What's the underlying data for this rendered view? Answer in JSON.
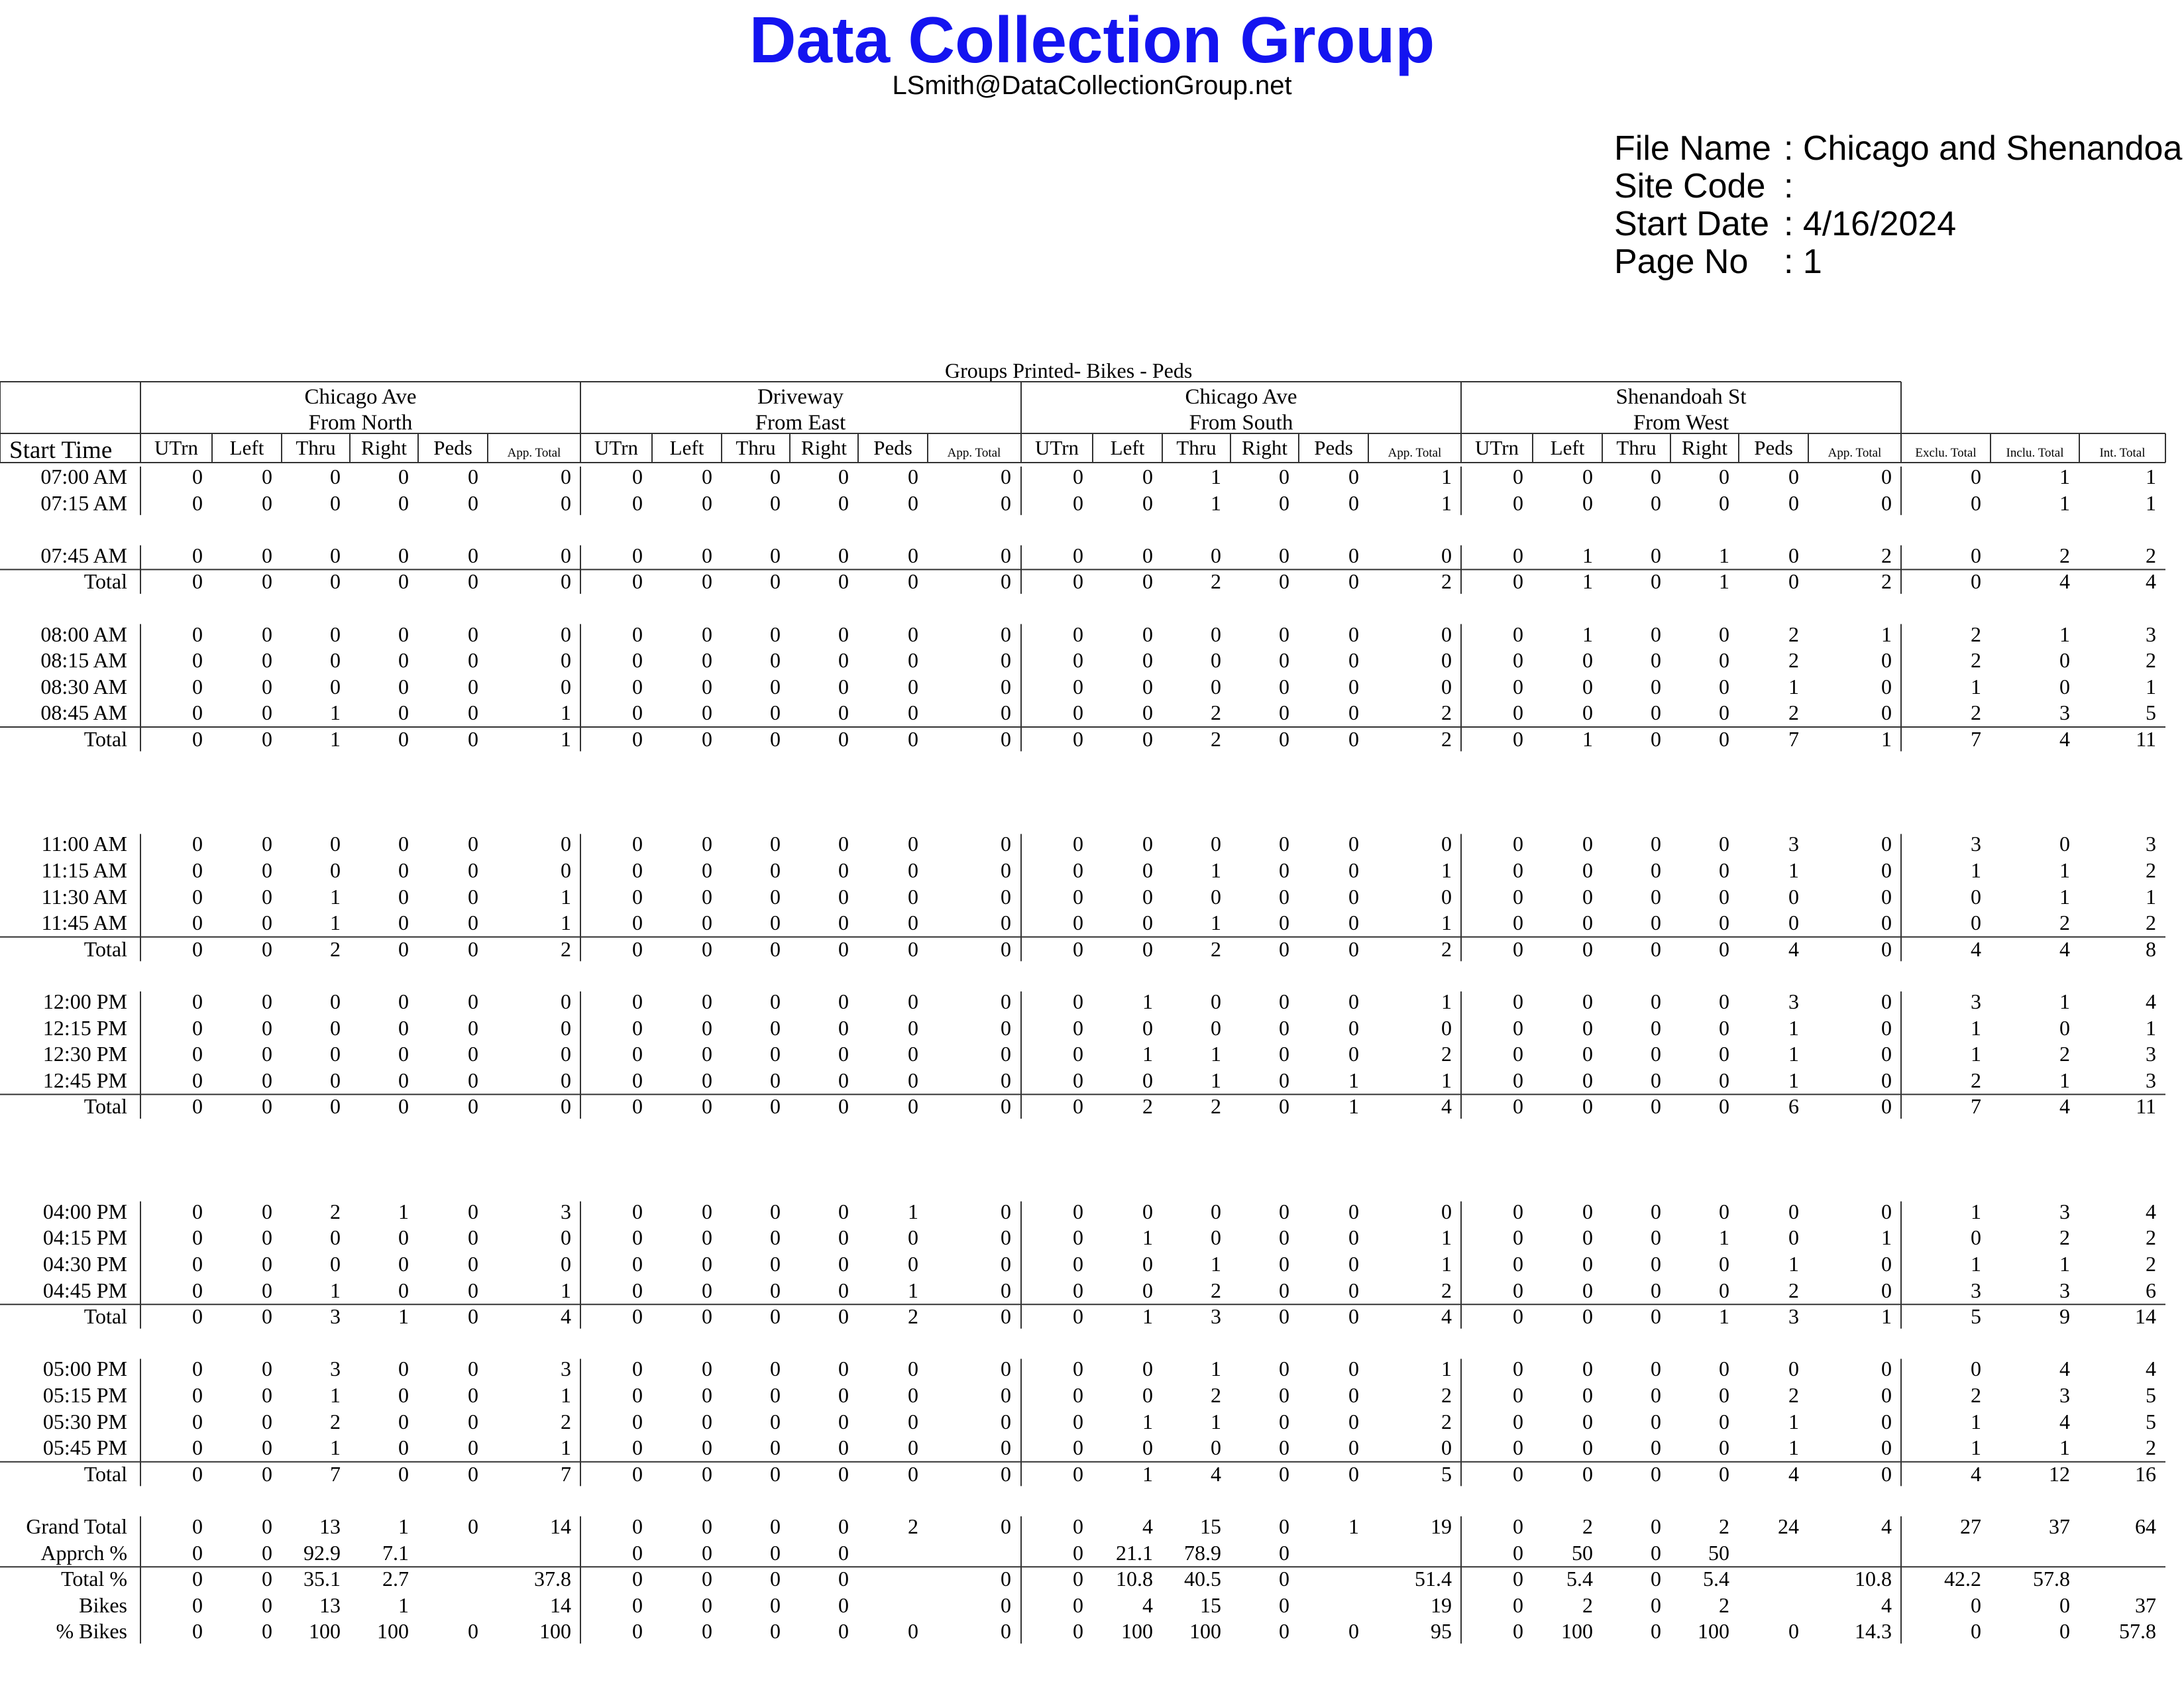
{
  "header": {
    "company": "Data Collection Group",
    "email": "LSmith@DataCollectionGroup.net",
    "info": [
      {
        "key": "File Name",
        "value": ": Chicago and Shenandoah"
      },
      {
        "key": "Site Code",
        "value": ":"
      },
      {
        "key": "Start Date",
        "value": ": 4/16/2024"
      },
      {
        "key": "Page No",
        "value": ": 1"
      }
    ]
  },
  "groups_printed": "Groups Printed- Bikes - Peds",
  "table": {
    "start_time_label": "Start Time",
    "approaches": [
      {
        "name": "Chicago Ave",
        "direction": "From North"
      },
      {
        "name": "Driveway",
        "direction": "From East"
      },
      {
        "name": "Chicago Ave",
        "direction": "From South"
      },
      {
        "name": "Shenandoah St",
        "direction": "From West"
      }
    ],
    "approach_columns": [
      "UTrn",
      "Left",
      "Thru",
      "Right",
      "Peds",
      "App. Total"
    ],
    "total_columns": [
      "Exclu. Total",
      "Inclu. Total",
      "Int. Total"
    ],
    "rows": [
      {
        "label": "07:00 AM",
        "type": "data",
        "values": [
          "0",
          "0",
          "0",
          "0",
          "0",
          "0",
          "0",
          "0",
          "0",
          "0",
          "0",
          "0",
          "0",
          "0",
          "1",
          "0",
          "0",
          "1",
          "0",
          "0",
          "0",
          "0",
          "0",
          "0",
          "0",
          "1",
          "1"
        ]
      },
      {
        "label": "07:15 AM",
        "type": "data",
        "values": [
          "0",
          "0",
          "0",
          "0",
          "0",
          "0",
          "0",
          "0",
          "0",
          "0",
          "0",
          "0",
          "0",
          "0",
          "1",
          "0",
          "0",
          "1",
          "0",
          "0",
          "0",
          "0",
          "0",
          "0",
          "0",
          "1",
          "1"
        ]
      },
      {
        "label": "",
        "type": "gap"
      },
      {
        "label": "07:45 AM",
        "type": "data",
        "values": [
          "0",
          "0",
          "0",
          "0",
          "0",
          "0",
          "0",
          "0",
          "0",
          "0",
          "0",
          "0",
          "0",
          "0",
          "0",
          "0",
          "0",
          "0",
          "0",
          "1",
          "0",
          "1",
          "0",
          "2",
          "0",
          "2",
          "2"
        ]
      },
      {
        "label": "Total",
        "type": "total",
        "values": [
          "0",
          "0",
          "0",
          "0",
          "0",
          "0",
          "0",
          "0",
          "0",
          "0",
          "0",
          "0",
          "0",
          "0",
          "2",
          "0",
          "0",
          "2",
          "0",
          "1",
          "0",
          "1",
          "0",
          "2",
          "0",
          "4",
          "4"
        ]
      },
      {
        "label": "",
        "type": "gap"
      },
      {
        "label": "08:00 AM",
        "type": "data",
        "values": [
          "0",
          "0",
          "0",
          "0",
          "0",
          "0",
          "0",
          "0",
          "0",
          "0",
          "0",
          "0",
          "0",
          "0",
          "0",
          "0",
          "0",
          "0",
          "0",
          "1",
          "0",
          "0",
          "2",
          "1",
          "2",
          "1",
          "3"
        ]
      },
      {
        "label": "08:15 AM",
        "type": "data",
        "values": [
          "0",
          "0",
          "0",
          "0",
          "0",
          "0",
          "0",
          "0",
          "0",
          "0",
          "0",
          "0",
          "0",
          "0",
          "0",
          "0",
          "0",
          "0",
          "0",
          "0",
          "0",
          "0",
          "2",
          "0",
          "2",
          "0",
          "2"
        ]
      },
      {
        "label": "08:30 AM",
        "type": "data",
        "values": [
          "0",
          "0",
          "0",
          "0",
          "0",
          "0",
          "0",
          "0",
          "0",
          "0",
          "0",
          "0",
          "0",
          "0",
          "0",
          "0",
          "0",
          "0",
          "0",
          "0",
          "0",
          "0",
          "1",
          "0",
          "1",
          "0",
          "1"
        ]
      },
      {
        "label": "08:45 AM",
        "type": "data",
        "values": [
          "0",
          "0",
          "1",
          "0",
          "0",
          "1",
          "0",
          "0",
          "0",
          "0",
          "0",
          "0",
          "0",
          "0",
          "2",
          "0",
          "0",
          "2",
          "0",
          "0",
          "0",
          "0",
          "2",
          "0",
          "2",
          "3",
          "5"
        ]
      },
      {
        "label": "Total",
        "type": "total",
        "values": [
          "0",
          "0",
          "1",
          "0",
          "0",
          "1",
          "0",
          "0",
          "0",
          "0",
          "0",
          "0",
          "0",
          "0",
          "2",
          "0",
          "0",
          "2",
          "0",
          "1",
          "0",
          "0",
          "7",
          "1",
          "7",
          "4",
          "11"
        ]
      },
      {
        "label": "",
        "type": "gap"
      },
      {
        "label": "",
        "type": "gap"
      },
      {
        "label": "",
        "type": "gap"
      },
      {
        "label": "11:00 AM",
        "type": "data",
        "values": [
          "0",
          "0",
          "0",
          "0",
          "0",
          "0",
          "0",
          "0",
          "0",
          "0",
          "0",
          "0",
          "0",
          "0",
          "0",
          "0",
          "0",
          "0",
          "0",
          "0",
          "0",
          "0",
          "3",
          "0",
          "3",
          "0",
          "3"
        ]
      },
      {
        "label": "11:15 AM",
        "type": "data",
        "values": [
          "0",
          "0",
          "0",
          "0",
          "0",
          "0",
          "0",
          "0",
          "0",
          "0",
          "0",
          "0",
          "0",
          "0",
          "1",
          "0",
          "0",
          "1",
          "0",
          "0",
          "0",
          "0",
          "1",
          "0",
          "1",
          "1",
          "2"
        ]
      },
      {
        "label": "11:30 AM",
        "type": "data",
        "values": [
          "0",
          "0",
          "1",
          "0",
          "0",
          "1",
          "0",
          "0",
          "0",
          "0",
          "0",
          "0",
          "0",
          "0",
          "0",
          "0",
          "0",
          "0",
          "0",
          "0",
          "0",
          "0",
          "0",
          "0",
          "0",
          "1",
          "1"
        ]
      },
      {
        "label": "11:45 AM",
        "type": "data",
        "values": [
          "0",
          "0",
          "1",
          "0",
          "0",
          "1",
          "0",
          "0",
          "0",
          "0",
          "0",
          "0",
          "0",
          "0",
          "1",
          "0",
          "0",
          "1",
          "0",
          "0",
          "0",
          "0",
          "0",
          "0",
          "0",
          "2",
          "2"
        ]
      },
      {
        "label": "Total",
        "type": "total",
        "values": [
          "0",
          "0",
          "2",
          "0",
          "0",
          "2",
          "0",
          "0",
          "0",
          "0",
          "0",
          "0",
          "0",
          "0",
          "2",
          "0",
          "0",
          "2",
          "0",
          "0",
          "0",
          "0",
          "4",
          "0",
          "4",
          "4",
          "8"
        ]
      },
      {
        "label": "",
        "type": "gap"
      },
      {
        "label": "12:00 PM",
        "type": "data",
        "values": [
          "0",
          "0",
          "0",
          "0",
          "0",
          "0",
          "0",
          "0",
          "0",
          "0",
          "0",
          "0",
          "0",
          "1",
          "0",
          "0",
          "0",
          "1",
          "0",
          "0",
          "0",
          "0",
          "3",
          "0",
          "3",
          "1",
          "4"
        ]
      },
      {
        "label": "12:15 PM",
        "type": "data",
        "values": [
          "0",
          "0",
          "0",
          "0",
          "0",
          "0",
          "0",
          "0",
          "0",
          "0",
          "0",
          "0",
          "0",
          "0",
          "0",
          "0",
          "0",
          "0",
          "0",
          "0",
          "0",
          "0",
          "1",
          "0",
          "1",
          "0",
          "1"
        ]
      },
      {
        "label": "12:30 PM",
        "type": "data",
        "values": [
          "0",
          "0",
          "0",
          "0",
          "0",
          "0",
          "0",
          "0",
          "0",
          "0",
          "0",
          "0",
          "0",
          "1",
          "1",
          "0",
          "0",
          "2",
          "0",
          "0",
          "0",
          "0",
          "1",
          "0",
          "1",
          "2",
          "3"
        ]
      },
      {
        "label": "12:45 PM",
        "type": "data",
        "values": [
          "0",
          "0",
          "0",
          "0",
          "0",
          "0",
          "0",
          "0",
          "0",
          "0",
          "0",
          "0",
          "0",
          "0",
          "1",
          "0",
          "1",
          "1",
          "0",
          "0",
          "0",
          "0",
          "1",
          "0",
          "2",
          "1",
          "3"
        ]
      },
      {
        "label": "Total",
        "type": "total",
        "values": [
          "0",
          "0",
          "0",
          "0",
          "0",
          "0",
          "0",
          "0",
          "0",
          "0",
          "0",
          "0",
          "0",
          "2",
          "2",
          "0",
          "1",
          "4",
          "0",
          "0",
          "0",
          "0",
          "6",
          "0",
          "7",
          "4",
          "11"
        ]
      },
      {
        "label": "",
        "type": "gap"
      },
      {
        "label": "",
        "type": "gap"
      },
      {
        "label": "",
        "type": "gap"
      },
      {
        "label": "04:00 PM",
        "type": "data",
        "values": [
          "0",
          "0",
          "2",
          "1",
          "0",
          "3",
          "0",
          "0",
          "0",
          "0",
          "1",
          "0",
          "0",
          "0",
          "0",
          "0",
          "0",
          "0",
          "0",
          "0",
          "0",
          "0",
          "0",
          "0",
          "1",
          "3",
          "4"
        ]
      },
      {
        "label": "04:15 PM",
        "type": "data",
        "values": [
          "0",
          "0",
          "0",
          "0",
          "0",
          "0",
          "0",
          "0",
          "0",
          "0",
          "0",
          "0",
          "0",
          "1",
          "0",
          "0",
          "0",
          "1",
          "0",
          "0",
          "0",
          "1",
          "0",
          "1",
          "0",
          "2",
          "2"
        ]
      },
      {
        "label": "04:30 PM",
        "type": "data",
        "values": [
          "0",
          "0",
          "0",
          "0",
          "0",
          "0",
          "0",
          "0",
          "0",
          "0",
          "0",
          "0",
          "0",
          "0",
          "1",
          "0",
          "0",
          "1",
          "0",
          "0",
          "0",
          "0",
          "1",
          "0",
          "1",
          "1",
          "2"
        ]
      },
      {
        "label": "04:45 PM",
        "type": "data",
        "values": [
          "0",
          "0",
          "1",
          "0",
          "0",
          "1",
          "0",
          "0",
          "0",
          "0",
          "1",
          "0",
          "0",
          "0",
          "2",
          "0",
          "0",
          "2",
          "0",
          "0",
          "0",
          "0",
          "2",
          "0",
          "3",
          "3",
          "6"
        ]
      },
      {
        "label": "Total",
        "type": "total",
        "values": [
          "0",
          "0",
          "3",
          "1",
          "0",
          "4",
          "0",
          "0",
          "0",
          "0",
          "2",
          "0",
          "0",
          "1",
          "3",
          "0",
          "0",
          "4",
          "0",
          "0",
          "0",
          "1",
          "3",
          "1",
          "5",
          "9",
          "14"
        ]
      },
      {
        "label": "",
        "type": "gap"
      },
      {
        "label": "05:00 PM",
        "type": "data",
        "values": [
          "0",
          "0",
          "3",
          "0",
          "0",
          "3",
          "0",
          "0",
          "0",
          "0",
          "0",
          "0",
          "0",
          "0",
          "1",
          "0",
          "0",
          "1",
          "0",
          "0",
          "0",
          "0",
          "0",
          "0",
          "0",
          "4",
          "4"
        ]
      },
      {
        "label": "05:15 PM",
        "type": "data",
        "values": [
          "0",
          "0",
          "1",
          "0",
          "0",
          "1",
          "0",
          "0",
          "0",
          "0",
          "0",
          "0",
          "0",
          "0",
          "2",
          "0",
          "0",
          "2",
          "0",
          "0",
          "0",
          "0",
          "2",
          "0",
          "2",
          "3",
          "5"
        ]
      },
      {
        "label": "05:30 PM",
        "type": "data",
        "values": [
          "0",
          "0",
          "2",
          "0",
          "0",
          "2",
          "0",
          "0",
          "0",
          "0",
          "0",
          "0",
          "0",
          "1",
          "1",
          "0",
          "0",
          "2",
          "0",
          "0",
          "0",
          "0",
          "1",
          "0",
          "1",
          "4",
          "5"
        ]
      },
      {
        "label": "05:45 PM",
        "type": "data",
        "values": [
          "0",
          "0",
          "1",
          "0",
          "0",
          "1",
          "0",
          "0",
          "0",
          "0",
          "0",
          "0",
          "0",
          "0",
          "0",
          "0",
          "0",
          "0",
          "0",
          "0",
          "0",
          "0",
          "1",
          "0",
          "1",
          "1",
          "2"
        ]
      },
      {
        "label": "Total",
        "type": "total",
        "values": [
          "0",
          "0",
          "7",
          "0",
          "0",
          "7",
          "0",
          "0",
          "0",
          "0",
          "0",
          "0",
          "0",
          "1",
          "4",
          "0",
          "0",
          "5",
          "0",
          "0",
          "0",
          "0",
          "4",
          "0",
          "4",
          "12",
          "16"
        ]
      },
      {
        "label": "",
        "type": "gap"
      },
      {
        "label": "Grand Total",
        "type": "summary",
        "values": [
          "0",
          "0",
          "13",
          "1",
          "0",
          "14",
          "0",
          "0",
          "0",
          "0",
          "2",
          "0",
          "0",
          "4",
          "15",
          "0",
          "1",
          "19",
          "0",
          "2",
          "0",
          "2",
          "24",
          "4",
          "27",
          "37",
          "64"
        ]
      },
      {
        "label": "Apprch %",
        "type": "summary",
        "values": [
          "0",
          "0",
          "92.9",
          "7.1",
          "",
          "",
          "0",
          "0",
          "0",
          "0",
          "",
          "",
          "0",
          "21.1",
          "78.9",
          "0",
          "",
          "",
          "0",
          "50",
          "0",
          "50",
          "",
          "",
          "",
          "",
          ""
        ]
      },
      {
        "label": "Total %",
        "type": "summary-total",
        "values": [
          "0",
          "0",
          "35.1",
          "2.7",
          "",
          "37.8",
          "0",
          "0",
          "0",
          "0",
          "",
          "0",
          "0",
          "10.8",
          "40.5",
          "0",
          "",
          "51.4",
          "0",
          "5.4",
          "0",
          "5.4",
          "",
          "10.8",
          "42.2",
          "57.8",
          ""
        ]
      },
      {
        "label": "Bikes",
        "type": "summary",
        "values": [
          "0",
          "0",
          "13",
          "1",
          "",
          "14",
          "0",
          "0",
          "0",
          "0",
          "",
          "0",
          "0",
          "4",
          "15",
          "0",
          "",
          "19",
          "0",
          "2",
          "0",
          "2",
          "",
          "4",
          "0",
          "0",
          "37"
        ]
      },
      {
        "label": "% Bikes",
        "type": "summary",
        "values": [
          "0",
          "0",
          "100",
          "100",
          "0",
          "100",
          "0",
          "0",
          "0",
          "0",
          "0",
          "0",
          "0",
          "100",
          "100",
          "0",
          "0",
          "95",
          "0",
          "100",
          "0",
          "100",
          "0",
          "14.3",
          "0",
          "0",
          "57.8"
        ]
      }
    ]
  }
}
